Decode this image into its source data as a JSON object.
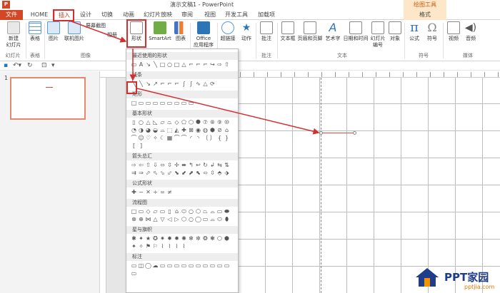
{
  "window": {
    "title": "演示文稿1 - PowerPoint",
    "context_tab_group": "绘图工具"
  },
  "tabs": [
    {
      "label": "文件"
    },
    {
      "label": "HOME"
    },
    {
      "label": "插入"
    },
    {
      "label": "设计"
    },
    {
      "label": "切换"
    },
    {
      "label": "动画"
    },
    {
      "label": "幻灯片放映"
    },
    {
      "label": "审阅"
    },
    {
      "label": "视图"
    },
    {
      "label": "开发工具"
    },
    {
      "label": "加载项"
    },
    {
      "label": "格式"
    }
  ],
  "ribbon": {
    "buttons": {
      "new_slide": "新建\n幻灯片",
      "table": "表格",
      "picture": "图片",
      "online_picture": "联机图片",
      "screenshot": "屏幕截图",
      "album": "相册",
      "shapes": "形状",
      "smartart": "SmartArt",
      "chart": "图表",
      "office_apps": "Office\n应用程序",
      "hyperlink": "超链接",
      "action": "动作",
      "comment": "批注",
      "textbox": "文本框",
      "header_footer": "页眉和页脚",
      "wordart": "艺术字",
      "date_time": "日期和时间",
      "slide_number": "幻灯片\n编号",
      "object": "对象",
      "equation": "公式",
      "symbol": "符号",
      "video": "视频",
      "audio": "音频"
    },
    "groups": {
      "slides": "幻灯片",
      "tables": "表格",
      "images": "图像",
      "comments": "批注",
      "text": "文本",
      "symbols": "符号",
      "media": "媒体"
    }
  },
  "qat": {
    "save_icon": "save-icon",
    "undo_icon": "undo-icon",
    "redo_icon": "redo-icon",
    "start_icon": "start-from-beginning-icon"
  },
  "slide_pane": {
    "slide_number": "1"
  },
  "shapes_menu": {
    "sections": [
      {
        "title": "最近使用的形状",
        "glyphs": [
          "▭",
          "A",
          "↘",
          "╲",
          "□",
          "○",
          "□",
          "△",
          "⌐",
          "⌐",
          "⌐",
          "↪",
          "⇨",
          "⇧"
        ]
      },
      {
        "title": "线条",
        "glyphs": [
          "╲",
          "╲",
          "↘",
          "↗",
          "⌐",
          "⌐",
          "⌐",
          "∫",
          "∫",
          "∿",
          "△",
          "⟳"
        ]
      },
      {
        "title": "矩形",
        "glyphs": [
          "□",
          "▭",
          "▭",
          "▭",
          "▭",
          "▭",
          "▭",
          "▭",
          "▭"
        ]
      },
      {
        "title": "基本形状",
        "glyphs": [
          "▯",
          "○",
          "△",
          "◺",
          "▱",
          "⏢",
          "◇",
          "⬠",
          "⬡",
          "⯃",
          "⑦",
          "⑧",
          "⑨",
          "⑩",
          "◔",
          "◑",
          "◕",
          "◒",
          "⌓",
          "⬚",
          "◭",
          "✚",
          "⊠",
          "◉",
          "◍",
          "⬢",
          "⊘",
          "⌂",
          "⌒",
          "☺",
          "♡",
          "✧",
          "☾",
          "▦",
          "⌒",
          "⌒",
          "◜",
          "◝",
          "〔",
          "〕",
          "{",
          "}",
          "[",
          "]"
        ]
      },
      {
        "title": "箭头总汇",
        "glyphs": [
          "⇨",
          "⇦",
          "⇧",
          "⇩",
          "⬄",
          "⇳",
          "✢",
          "⬌",
          "↰",
          "↩",
          "↻",
          "↲",
          "⇆",
          "⇅",
          "⇉",
          "⇒",
          "⬀",
          "⬁",
          "⬂",
          "⬃",
          "⬊",
          "⬋",
          "⬈",
          "⬉",
          "⬄",
          "⇳",
          "⬘",
          "⬗"
        ]
      },
      {
        "title": "公式形状",
        "glyphs": [
          "✚",
          "−",
          "✕",
          "÷",
          "=",
          "≠"
        ]
      },
      {
        "title": "流程图",
        "glyphs": [
          "□",
          "▭",
          "◇",
          "▱",
          "▭",
          "▯",
          "⌂",
          "⬭",
          "○",
          "⬡",
          "⏢",
          "⌓",
          "▭",
          "⬬",
          "⊗",
          "⊕",
          "⋈",
          "△",
          "▽",
          "◁",
          "▷",
          "⬡",
          "○",
          "◯",
          "▭",
          "⌓",
          "⬭",
          "⬮"
        ]
      },
      {
        "title": "星与旗帜",
        "glyphs": [
          "✱",
          "✦",
          "★",
          "✪",
          "✷",
          "✸",
          "✹",
          "✺",
          "✻",
          "✼",
          "❂",
          "❃",
          "⬡",
          "⬢",
          "✦",
          "✧",
          "⚑",
          "⚐",
          "⌇",
          "⌇",
          "⌇",
          "⌇"
        ]
      },
      {
        "title": "标注",
        "glyphs": [
          "▭",
          "◫",
          "◯",
          "☁",
          "▭",
          "▭",
          "▭",
          "▭",
          "▭",
          "▭",
          "▭",
          "▭",
          "▭",
          "▭",
          "▭"
        ]
      }
    ]
  },
  "watermark": {
    "brand": "PPT家园",
    "url": "pptjia.com"
  },
  "colors": {
    "accent": "#d24726",
    "highlight": "#d32f2f",
    "shape_line": "#c0504d"
  }
}
